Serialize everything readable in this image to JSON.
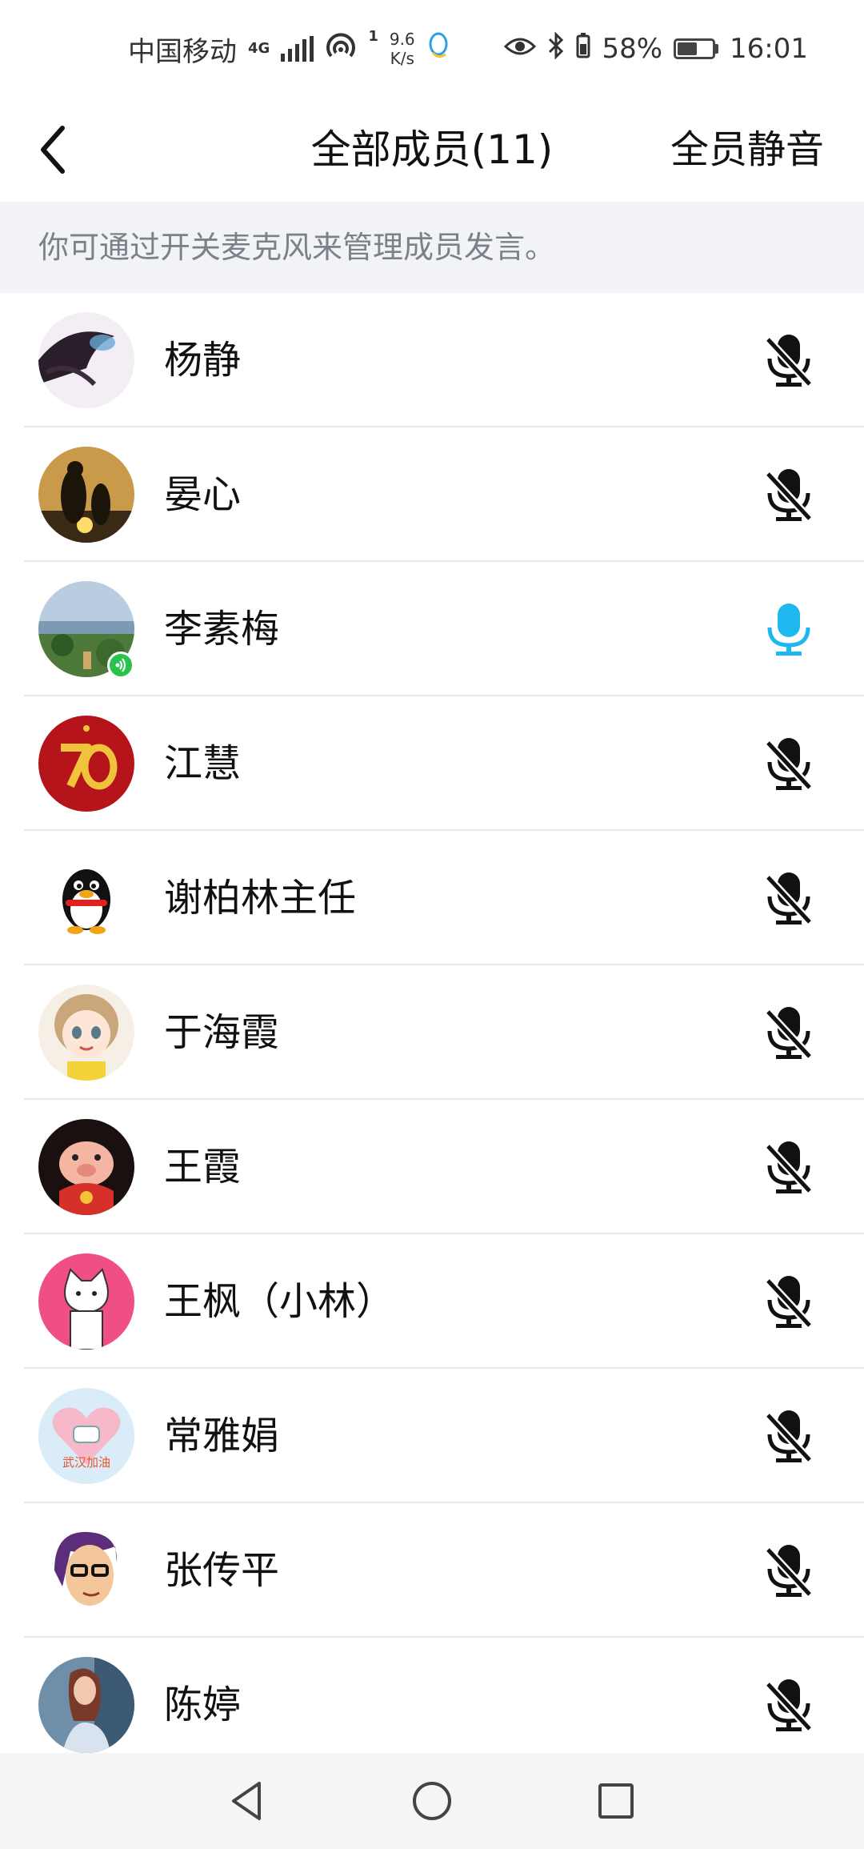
{
  "status_bar": {
    "carrier": "中国移动",
    "network": "4G",
    "hotspot_count": "1",
    "speed_value": "9.6",
    "speed_unit": "K/s",
    "battery": "58%",
    "time": "16:01"
  },
  "header": {
    "title": "全部成员(11)",
    "mute_all_label": "全员静音"
  },
  "hint": "你可通过开关麦克风来管理成员发言。",
  "colors": {
    "mic_active": "#1fb7ef",
    "mic_muted": "#111111",
    "speaking_badge": "#29c24a"
  },
  "members": [
    {
      "name": "杨静",
      "mic": "muted",
      "avatar": "dark-swirl-avatar"
    },
    {
      "name": "晏心",
      "mic": "muted",
      "avatar": "penguin-sunset-avatar"
    },
    {
      "name": "李素梅",
      "mic": "on",
      "speaking": true,
      "avatar": "landscape-avatar"
    },
    {
      "name": "江慧",
      "mic": "muted",
      "avatar": "red-70-avatar"
    },
    {
      "name": "谢柏林主任",
      "mic": "muted",
      "avatar": "qq-penguin-avatar"
    },
    {
      "name": "于海霞",
      "mic": "muted",
      "avatar": "anime-girl-avatar"
    },
    {
      "name": "王霞",
      "mic": "muted",
      "avatar": "cartoon-pig-avatar"
    },
    {
      "name": "王枫（小林）",
      "mic": "muted",
      "avatar": "white-cat-avatar"
    },
    {
      "name": "常雅娟",
      "mic": "muted",
      "avatar": "wuhan-heart-avatar",
      "avatar_text": "武汉加油"
    },
    {
      "name": "张传平",
      "mic": "muted",
      "avatar": "glasses-man-avatar"
    },
    {
      "name": "陈婷",
      "mic": "muted",
      "avatar": "painted-woman-avatar"
    }
  ]
}
